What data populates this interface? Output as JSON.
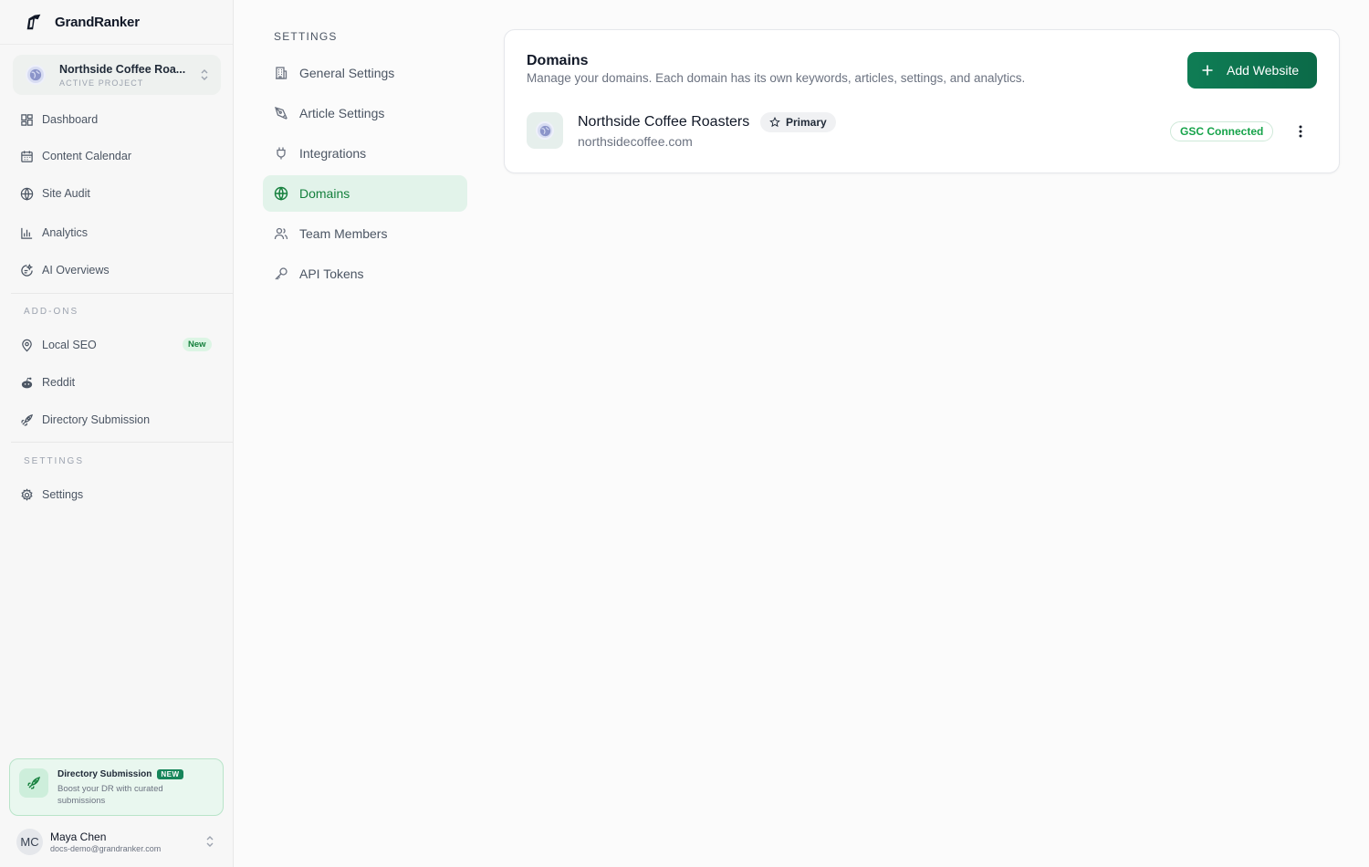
{
  "app": {
    "name": "GrandRanker"
  },
  "project": {
    "name": "Northside Coffee Roa...",
    "subtitle": "ACTIVE PROJECT"
  },
  "sidebar": {
    "items": [
      {
        "label": "Dashboard",
        "icon": "dashboard-grid-icon"
      },
      {
        "label": "Content Calendar",
        "icon": "calendar-icon"
      },
      {
        "label": "Site Audit",
        "icon": "globe-icon"
      },
      {
        "label": "Analytics",
        "icon": "bar-chart-icon"
      },
      {
        "label": "AI Overviews",
        "icon": "ai-overviews-icon"
      }
    ],
    "addons_label": "ADD-ONS",
    "addons": [
      {
        "label": "Local SEO",
        "icon": "map-pin-icon",
        "badge": "New"
      },
      {
        "label": "Reddit",
        "icon": "reddit-icon"
      },
      {
        "label": "Directory Submission",
        "icon": "rocket-icon"
      }
    ],
    "settings_label": "SETTINGS",
    "settings_item": {
      "label": "Settings",
      "icon": "gear-icon"
    },
    "promo": {
      "title": "Directory Submission",
      "badge": "NEW",
      "description": "Boost your DR with curated submissions"
    },
    "user": {
      "initials": "MC",
      "name": "Maya Chen",
      "email": "docs-demo@grandranker.com"
    }
  },
  "settings_nav": {
    "heading": "SETTINGS",
    "items": [
      {
        "label": "General Settings",
        "icon": "building-icon"
      },
      {
        "label": "Article Settings",
        "icon": "pen-tool-icon"
      },
      {
        "label": "Integrations",
        "icon": "plug-icon"
      },
      {
        "label": "Domains",
        "icon": "globe-icon",
        "active": true
      },
      {
        "label": "Team Members",
        "icon": "users-icon"
      },
      {
        "label": "API Tokens",
        "icon": "key-icon"
      }
    ]
  },
  "domains": {
    "title": "Domains",
    "description": "Manage your domains. Each domain has its own keywords, articles, settings, and analytics.",
    "add_button": "Add Website",
    "list": [
      {
        "name": "Northside Coffee Roasters",
        "url": "northsidecoffee.com",
        "primary_label": "Primary",
        "status": "GSC Connected"
      }
    ]
  },
  "colors": {
    "accent": "#15803d",
    "button": "#0f7d55",
    "active_bg": "#e2f3ea"
  }
}
